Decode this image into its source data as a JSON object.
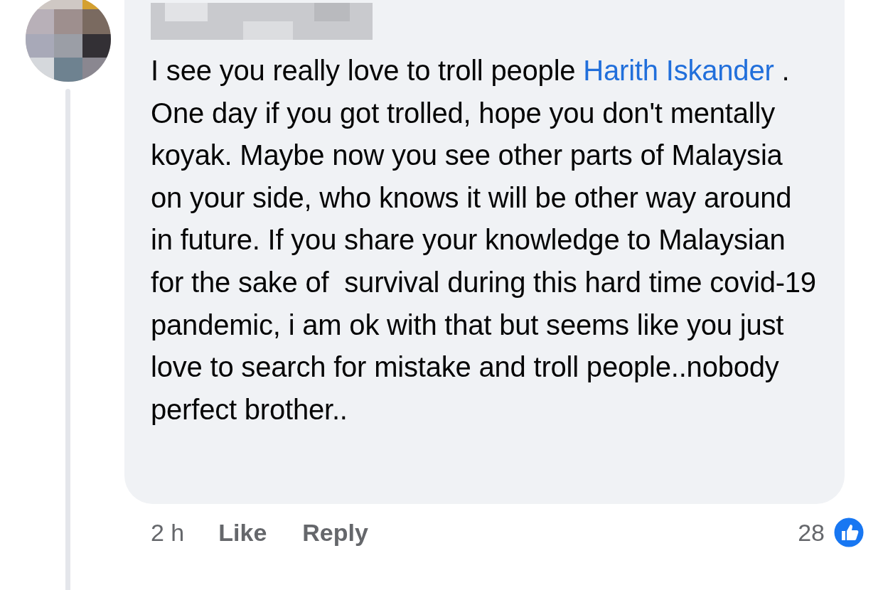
{
  "comment": {
    "text_before": "I see you really love to troll people",
    "mention": "Harith Iskander",
    "text_after": " . One day if you got trolled, hope you don't mentally koyak. Maybe now you see other parts of Malaysia on your side, who knows it will be other way around in future. If you share your knowledge to Malaysian for the sake of  survival during this hard time covid-19 pandemic, i am ok with that but seems like you just love to search for mistake and troll people..nobody perfect brother..",
    "time": "2 h",
    "actions": [
      {
        "label": "Like"
      },
      {
        "label": "Reply"
      }
    ],
    "reaction_count": "28"
  }
}
